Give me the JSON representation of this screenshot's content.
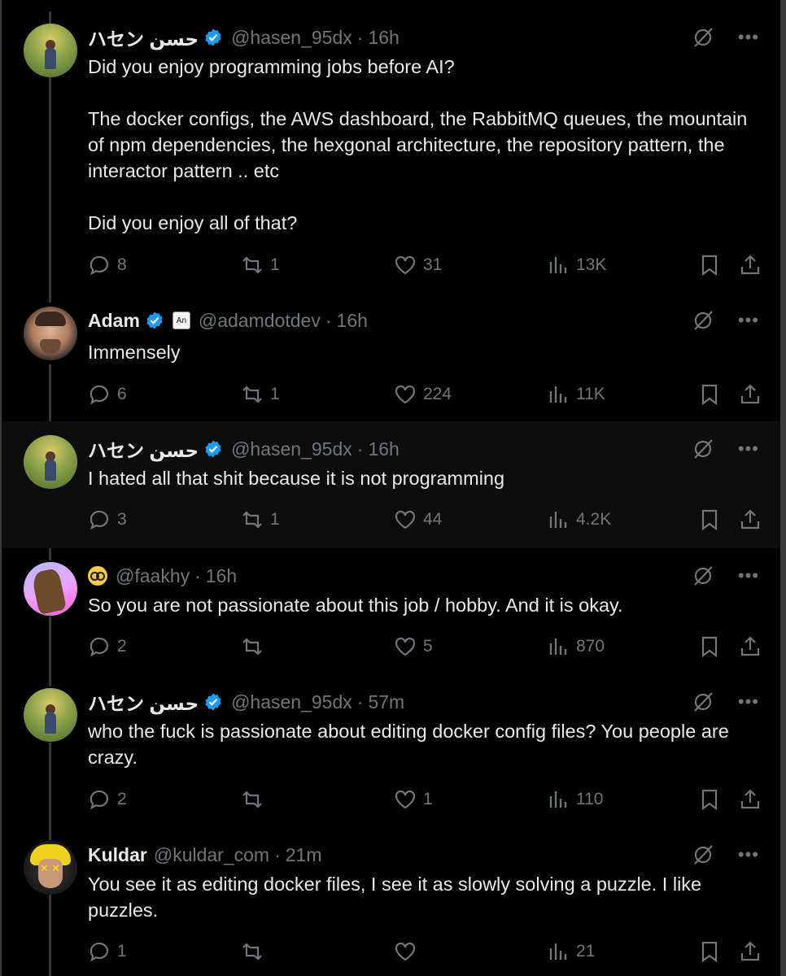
{
  "tweets": [
    {
      "name": "ハセン حسن",
      "handle": "@hasen_95dx",
      "time": "16h",
      "avatar": "hasen",
      "verified": true,
      "text": "Did you enjoy programming jobs before AI?\n\nThe docker configs, the AWS dashboard, the RabbitMQ queues, the mountain of npm dependencies, the hexgonal architecture, the repository pattern, the interactor pattern .. etc\n\nDid you enjoy all of that?",
      "replies": "8",
      "reposts": "1",
      "likes": "31",
      "views": "13K"
    },
    {
      "name": "Adam",
      "handle": "@adamdotdev",
      "time": "16h",
      "avatar": "adam",
      "verified": true,
      "affiliation_badge": "An",
      "text": "Immensely",
      "replies": "6",
      "reposts": "1",
      "likes": "224",
      "views": "11K"
    },
    {
      "name": "ハセン حسن",
      "handle": "@hasen_95dx",
      "time": "16h",
      "avatar": "hasen",
      "verified": true,
      "text": "I hated all that shit because it is not programming",
      "replies": "3",
      "reposts": "1",
      "likes": "44",
      "views": "4.2K"
    },
    {
      "name": "",
      "handle": "@faakhy",
      "time": "16h",
      "avatar": "faakhy",
      "name_emoji": "nerd-face-emoji",
      "text": "So you are not passionate about this job / hobby. And it is okay.",
      "replies": "2",
      "reposts": "",
      "likes": "5",
      "views": "870"
    },
    {
      "name": "ハセン حسن",
      "handle": "@hasen_95dx",
      "time": "57m",
      "avatar": "hasen",
      "verified": true,
      "text": "who the fuck is passionate about editing docker config files? You people are crazy.",
      "replies": "2",
      "reposts": "",
      "likes": "1",
      "views": "110"
    },
    {
      "name": "Kuldar",
      "handle": "@kuldar_com",
      "time": "21m",
      "avatar": "kuldar",
      "text": "You see it as editing docker files, I see it as slowly solving a puzzle. I like puzzles.",
      "replies": "1",
      "reposts": "",
      "likes": "",
      "views": "21"
    }
  ],
  "colors": {
    "background": "#000000",
    "highlight_background": "#0d0d0d",
    "text": "#e7e9ea",
    "muted": "#71767b",
    "verified_blue": "#1d9bf0"
  },
  "icons": [
    "reply-icon",
    "repost-icon",
    "like-icon",
    "views-icon",
    "bookmark-icon",
    "share-icon",
    "grok-icon",
    "more-icon",
    "verified-icon"
  ]
}
